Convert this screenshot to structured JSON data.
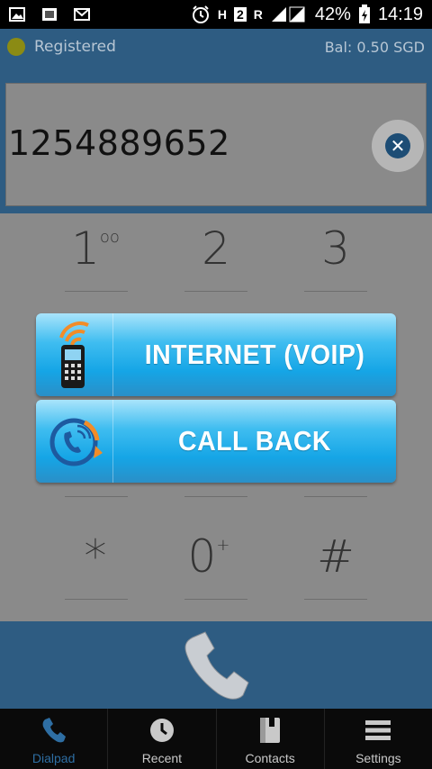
{
  "status_bar": {
    "battery": "42%",
    "time": "14:19",
    "network_h": "H",
    "sim": "2",
    "roaming": "R"
  },
  "header": {
    "status": "Registered",
    "balance": "Bal: 0.50 SGD"
  },
  "dialer": {
    "number": "1254889652"
  },
  "keypad": {
    "row1": [
      "1",
      "2",
      "3"
    ],
    "row1_sup": "oo",
    "row4": [
      "*",
      "0",
      "#"
    ],
    "zero_sup": "+"
  },
  "options": {
    "internet_label": "INTERNET (VOIP)",
    "callback_label": "CALL BACK"
  },
  "nav": {
    "items": [
      {
        "label": "Dialpad",
        "active": true
      },
      {
        "label": "Recent"
      },
      {
        "label": "Contacts"
      },
      {
        "label": "Settings"
      }
    ]
  },
  "colors": {
    "brand_blue": "#2e5c82",
    "button_blue": "#15a5e6",
    "active_nav": "#2e6ea3"
  }
}
